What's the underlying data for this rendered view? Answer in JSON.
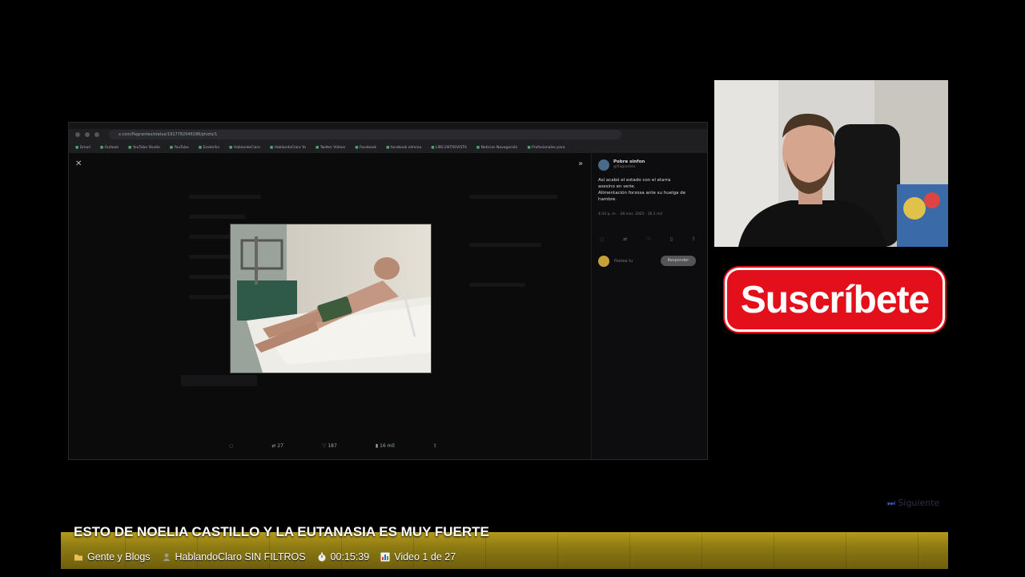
{
  "capture": {
    "url": "x.com/flagrantes/status/1917782046186/photo/1",
    "bookmarks": [
      "Gmail",
      "Outlook",
      "YouTube Studio",
      "YouTube",
      "Ezoteriks",
      "HablandoClaro",
      "HablandoClaro Yo",
      "Twitter Vídeos",
      "Facebook",
      "facebook elimina",
      "LIBS ENTREVISTA",
      "Noticias Navegación",
      "Profesionales para"
    ],
    "actions": {
      "reply": "",
      "retweet": "27",
      "like": "187",
      "views": "16 mil"
    },
    "tweet": {
      "name": "Pobre sinfon",
      "handle": "@flagrantes",
      "text_lines": [
        "Así acabó el estado con el etarra",
        "asesino en serie.",
        "Alimentación forzosa ante su huelga de",
        "hambre."
      ],
      "meta": "4:34 p. m. · 28 mar. 2025 · 16,1 mil",
      "reply_placeholder": "Postea tu",
      "reply_button": "Responder"
    }
  },
  "subscribe_label": "Suscríbete",
  "next_label": "Siguiente",
  "video": {
    "title": "ESTO DE NOELIA CASTILLO Y LA EUTANASIA ES MUY FUERTE",
    "category": "Gente y Blogs",
    "channel": "HablandoClaro SIN FILTROS",
    "duration": "00:15:39",
    "position": "Video 1 de 27"
  },
  "colors": {
    "subscribe_red": "#e3101c",
    "bar_gold": "#b49a1c",
    "next_blue": "#3a5bbf"
  },
  "icons": {
    "category": "folder-icon",
    "channel": "person-icon",
    "duration": "stopwatch-icon",
    "position": "chart-icon"
  }
}
